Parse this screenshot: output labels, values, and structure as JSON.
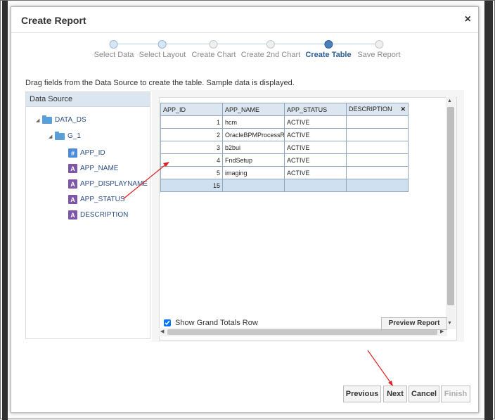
{
  "dialog": {
    "title": "Create Report",
    "close_glyph": "×"
  },
  "train": {
    "steps": [
      {
        "label": "Select Data",
        "state": "done"
      },
      {
        "label": "Select Layout",
        "state": "done"
      },
      {
        "label": "Create Chart",
        "state": "future"
      },
      {
        "label": "Create 2nd Chart",
        "state": "future"
      },
      {
        "label": "Create Table",
        "state": "current"
      },
      {
        "label": "Save Report",
        "state": "future"
      }
    ]
  },
  "instruction": "Drag fields from the Data Source to create the table. Sample data is displayed.",
  "data_source": {
    "header": "Data Source",
    "root": "DATA_DS",
    "group": "G_1",
    "fields": [
      {
        "name": "APP_ID",
        "icon": "numeric-field-icon",
        "glyph": "#"
      },
      {
        "name": "APP_NAME",
        "icon": "text-field-icon",
        "glyph": "A"
      },
      {
        "name": "APP_DISPLAYNAME",
        "icon": "text-field-icon",
        "glyph": "A"
      },
      {
        "name": "APP_STATUS",
        "icon": "text-field-icon",
        "glyph": "A"
      },
      {
        "name": "DESCRIPTION",
        "icon": "text-field-icon",
        "glyph": "A"
      }
    ]
  },
  "table": {
    "columns": [
      "APP_ID",
      "APP_NAME",
      "APP_STATUS",
      "DESCRIPTION"
    ],
    "remove_glyph": "✕",
    "rows": [
      [
        "1",
        "hcm",
        "ACTIVE",
        ""
      ],
      [
        "2",
        "OracleBPMProcessRo",
        "ACTIVE",
        ""
      ],
      [
        "3",
        "b2bui",
        "ACTIVE",
        ""
      ],
      [
        "4",
        "FndSetup",
        "ACTIVE",
        ""
      ],
      [
        "5",
        "imaging",
        "ACTIVE",
        ""
      ]
    ],
    "total_row": [
      "15",
      "",
      "",
      ""
    ],
    "grand_totals_label": "Show Grand Totals Row",
    "grand_totals_checked": true,
    "preview_label": "Preview Report"
  },
  "buttons": {
    "previous": "Previous",
    "next": "Next",
    "cancel": "Cancel",
    "finish": "Finish"
  },
  "colors": {
    "accent": "#2b5f97",
    "annotation_arrow": "#e02020"
  }
}
